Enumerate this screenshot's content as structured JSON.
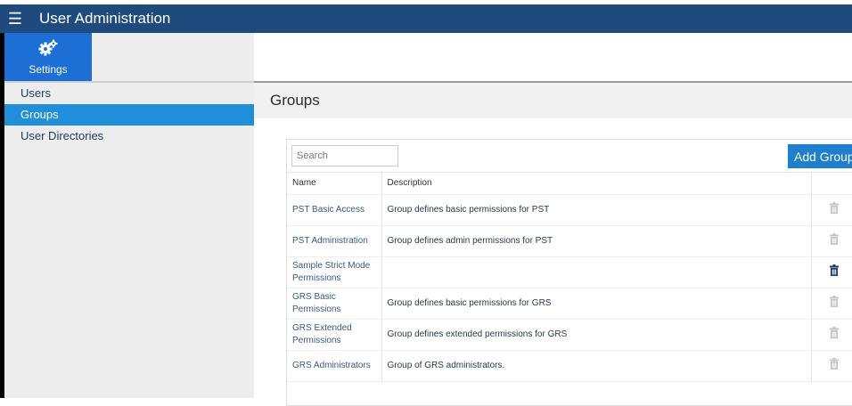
{
  "app": {
    "title": "User Administration",
    "menu_icon": "hamburger-menu-icon"
  },
  "colors": {
    "header": "#1e4a7e",
    "accent": "#1f8fdb",
    "button": "#1c7fcf"
  },
  "settings": {
    "label": "Settings",
    "icon": "gears-icon"
  },
  "sidebar": {
    "items": [
      {
        "label": "Users",
        "active": false
      },
      {
        "label": "Groups",
        "active": true
      },
      {
        "label": "User Directories",
        "active": false
      }
    ]
  },
  "page": {
    "title": "Groups"
  },
  "toolbar": {
    "search_placeholder": "Search",
    "add_label": "Add Group"
  },
  "table": {
    "headers": [
      "Name",
      "Description",
      ""
    ],
    "rows": [
      {
        "name": "PST Basic Access",
        "description": "Group defines basic permissions for PST",
        "icon_state": "light"
      },
      {
        "name": "PST Administration",
        "description": "Group defines admin permissions for PST",
        "icon_state": "light"
      },
      {
        "name": "Sample Strict Mode Permissions",
        "description": "",
        "icon_state": "dark"
      },
      {
        "name": "GRS Basic Permissions",
        "description": "Group defines basic permissions for GRS",
        "icon_state": "light"
      },
      {
        "name": "GRS Extended Permissions",
        "description": "Group defines extended permissions for GRS",
        "icon_state": "light"
      },
      {
        "name": "GRS Administrators",
        "description": "Group of GRS administrators.",
        "icon_state": "light"
      }
    ]
  }
}
